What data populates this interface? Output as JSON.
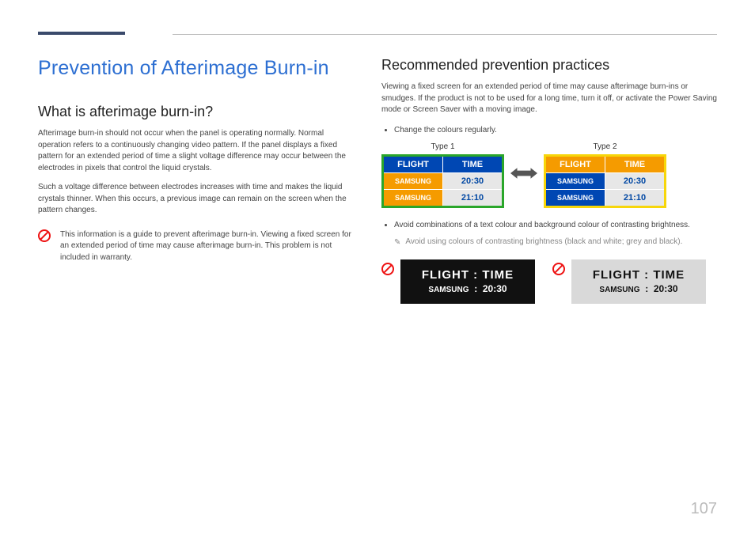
{
  "title": "Prevention of Afterimage Burn-in",
  "left": {
    "heading": "What is afterimage burn-in?",
    "p1": "Afterimage burn-in should not occur when the panel is operating normally. Normal operation refers to a continuously changing video pattern. If the panel displays a fixed pattern for an extended period of time a slight voltage difference may occur between the electrodes in pixels that control the liquid crystals.",
    "p2": "Such a voltage difference between electrodes increases with time and makes the liquid crystals thinner. When this occurs, a previous image can remain on the screen when the pattern changes.",
    "note": "This information is a guide to prevent afterimage burn-in. Viewing a fixed screen for an extended period of time may cause afterimage burn-in. This problem is not included in warranty."
  },
  "right": {
    "heading": "Recommended prevention practices",
    "p1": "Viewing a fixed screen for an extended period of time may cause afterimage burn-ins or smudges. If the product is not to be used for a long time, turn it off, or activate the Power Saving mode or Screen Saver with a moving image.",
    "bullet1": "Change the colours regularly.",
    "type1": "Type 1",
    "type2": "Type 2",
    "table": {
      "h1": "FLIGHT",
      "h2": "TIME",
      "r1c1": "SAMSUNG",
      "r1c2": "20:30",
      "r2c1": "SAMSUNG",
      "r2c2": "21:10"
    },
    "bullet2": "Avoid combinations of a text colour and background colour of contrasting brightness.",
    "pencil": "Avoid using colours of contrasting brightness (black and white; grey and black).",
    "panel": {
      "row1": "FLIGHT   :   TIME",
      "lab": "SAMSUNG",
      "sep": ":",
      "time": "20:30"
    }
  },
  "pageNumber": "107"
}
